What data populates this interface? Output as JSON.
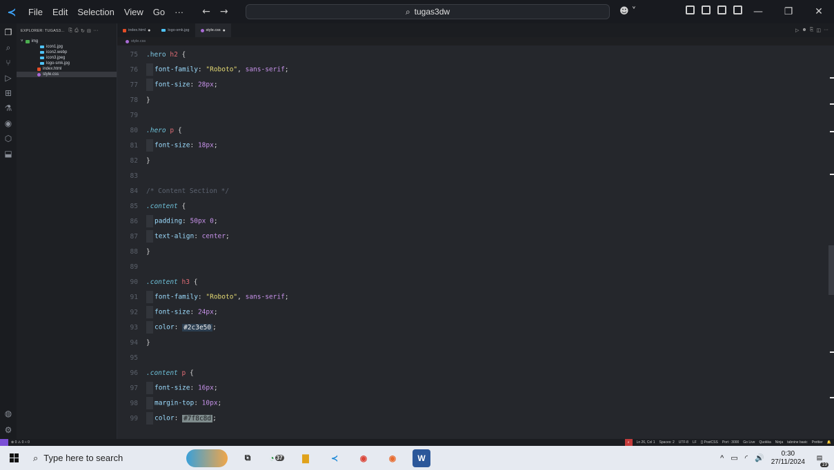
{
  "titlebar": {
    "menu": [
      "File",
      "Edit",
      "Selection",
      "View",
      "Go",
      "···"
    ],
    "search_text": "tugas3dw"
  },
  "sidebar": {
    "header": "EXPLORER: TUGAS3...",
    "folder": "img",
    "folder_files": [
      "icon1.jpg",
      "icon2.webp",
      "icon3.jpeg",
      "logo-smk.jpg"
    ],
    "files": [
      "index.html",
      "style.css"
    ]
  },
  "tabs": [
    {
      "label": "index.html",
      "modified": "●"
    },
    {
      "label": "logo-smk.jpg",
      "modified": ""
    },
    {
      "label": "style.css",
      "modified": "●"
    }
  ],
  "breadcrumb": "style.css",
  "code_lines": [
    {
      "n": "75",
      "html": "<span class='sel'>.hero</span> <span class='elem'>h2</span> <span class='punct'>{</span>"
    },
    {
      "n": "76",
      "html": "<span class='indent'></span><span class='prop'>font-family</span><span class='punct'>: </span><span class='str'>\"Roboto\"</span><span class='punct'>, </span><span class='kw'>sans-serif</span><span class='punct'>;</span>"
    },
    {
      "n": "77",
      "html": "<span class='indent'></span><span class='prop'>font-size</span><span class='punct'>: </span><span class='num'>28px</span><span class='punct'>;</span>"
    },
    {
      "n": "78",
      "html": "<span class='punct'>}</span>"
    },
    {
      "n": "79",
      "html": ""
    },
    {
      "n": "80",
      "html": "<span class='sel-i'>.hero</span> <span class='elem'>p</span> <span class='punct'>{</span>"
    },
    {
      "n": "81",
      "html": "<span class='indent'></span><span class='prop'>font-size</span><span class='punct'>: </span><span class='num'>18px</span><span class='punct'>;</span>"
    },
    {
      "n": "82",
      "html": "<span class='punct'>}</span>"
    },
    {
      "n": "83",
      "html": ""
    },
    {
      "n": "84",
      "html": "<span class='comment'>/* Content Section */</span>"
    },
    {
      "n": "85",
      "html": "<span class='sel-i'>.content</span> <span class='punct'>{</span>"
    },
    {
      "n": "86",
      "html": "<span class='indent'></span><span class='prop'>padding</span><span class='punct'>: </span><span class='num'>50px 0</span><span class='punct'>;</span>"
    },
    {
      "n": "87",
      "html": "<span class='indent'></span><span class='prop'>text-align</span><span class='punct'>: </span><span class='kw'>center</span><span class='punct'>;</span>"
    },
    {
      "n": "88",
      "html": "<span class='punct'>}</span>"
    },
    {
      "n": "89",
      "html": ""
    },
    {
      "n": "90",
      "html": "<span class='sel-i'>.content</span> <span class='elem'>h3</span> <span class='punct'>{</span>"
    },
    {
      "n": "91",
      "html": "<span class='indent'></span><span class='prop'>font-family</span><span class='punct'>: </span><span class='str'>\"Roboto\"</span><span class='punct'>, </span><span class='kw'>sans-serif</span><span class='punct'>;</span>"
    },
    {
      "n": "92",
      "html": "<span class='indent'></span><span class='prop'>font-size</span><span class='punct'>: </span><span class='num'>24px</span><span class='punct'>;</span>"
    },
    {
      "n": "93",
      "html": "<span class='indent'></span><span class='prop'>color</span><span class='punct'>: </span><span class='colorchip chip-dark'>#2c3e50</span><span class='punct'>;</span>"
    },
    {
      "n": "94",
      "html": "<span class='punct'>}</span>"
    },
    {
      "n": "95",
      "html": ""
    },
    {
      "n": "96",
      "html": "<span class='sel-i'>.content</span> <span class='elem'>p</span> <span class='punct'>{</span>"
    },
    {
      "n": "97",
      "html": "<span class='indent'></span><span class='prop'>font-size</span><span class='punct'>: </span><span class='num'>16px</span><span class='punct'>;</span>"
    },
    {
      "n": "98",
      "html": "<span class='indent'></span><span class='prop'>margin-top</span><span class='punct'>: </span><span class='num'>10px</span><span class='punct'>;</span>"
    },
    {
      "n": "99",
      "html": "<span class='indent'></span><span class='prop'>color</span><span class='punct'>: </span><span class='colorchip chip-grey'>#7f8c8d</span><span class='punct'>;</span>"
    }
  ],
  "statusbar": {
    "left": "⊗ 0 ⚠ 0   ⑃ 0",
    "items": [
      "Ln 26, Col 1",
      "Spaces: 2",
      "UTF-8",
      "LF",
      "{} PostCSS",
      "Port : 3000",
      "Go Live",
      "Quokka",
      "Ninja",
      "tabnine basic",
      "Prettier"
    ]
  },
  "taskbar": {
    "search_placeholder": "Type here to search",
    "whatsapp_badge": "37",
    "time": "0:30",
    "date": "27/11/2024",
    "notifications": "19"
  },
  "colors": {
    "editor_bg": "#25272c",
    "sidebar_bg": "#1e2024",
    "accent": "#3ea6ff"
  }
}
